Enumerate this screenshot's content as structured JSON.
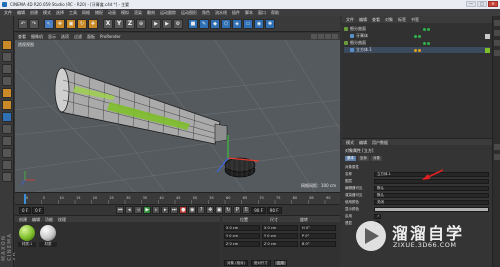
{
  "window": {
    "title": "CINEMA 4D R20.059 Studio (RC - R20) - [牙膏盒.c4d *] - 主要",
    "min": "—",
    "max": "□",
    "close": "✕"
  },
  "menu": [
    "文件",
    "编辑",
    "创建",
    "模式",
    "选择",
    "工具",
    "网格",
    "捕捉",
    "动画",
    "模拟",
    "渲染",
    "雕刻",
    "运动跟踪",
    "运动图形",
    "角色",
    "流水线",
    "插件",
    "脚本",
    "窗口",
    "帮助"
  ],
  "toolbar": {
    "axis_x": "X",
    "axis_y": "Y",
    "axis_z": "Z",
    "coord": "⊕"
  },
  "viewport": {
    "menu": [
      "查看",
      "摄像机",
      "显示",
      "选项",
      "过滤",
      "面板",
      "ProRender"
    ],
    "label": "透视视图",
    "grid_info": "网格间距：100 cm"
  },
  "timeline": {
    "ticks": [
      "0",
      "5",
      "10",
      "15",
      "20",
      "25",
      "30",
      "35",
      "40",
      "45",
      "50",
      "55",
      "60",
      "65",
      "70",
      "75",
      "80",
      "85",
      "90"
    ],
    "end_marker": "0 F"
  },
  "playback": {
    "start": "0 F",
    "current": "0 F",
    "end": "90 F",
    "end2": "90 F"
  },
  "materials": {
    "menu": [
      "创建",
      "编辑",
      "功能",
      "纹理"
    ],
    "items": [
      {
        "label": "材质.1",
        "color": "#7fbf2a"
      },
      {
        "label": "材质",
        "color": "#d9d9d9"
      }
    ]
  },
  "coordinates": {
    "headers": [
      "位置",
      "尺寸",
      "旋转"
    ],
    "rows": [
      [
        "X 0 cm",
        "X 0 cm",
        "H 0°"
      ],
      [
        "Y 0 cm",
        "Y 0 cm",
        "P 0°"
      ],
      [
        "Z 0 cm",
        "Z 0 cm",
        "B 0°"
      ]
    ],
    "mode": "对象 (相对)",
    "size_mode": "绝对尺寸",
    "apply": "应用"
  },
  "objects": {
    "tabs": [
      "文件",
      "编辑",
      "查看",
      "对象",
      "标签",
      "书签"
    ],
    "rows": [
      {
        "name": "细分曲面",
        "indent": 0
      },
      {
        "name": "牙膏体",
        "indent": 1
      },
      {
        "name": "细分曲面",
        "indent": 0
      },
      {
        "name": "立方体.1",
        "indent": 1
      }
    ]
  },
  "attributes": {
    "tabs": [
      "模式",
      "编辑",
      "用户数据"
    ],
    "title": "对象属性 [立方]",
    "subtabs": [
      "基本",
      "坐标",
      "对象"
    ],
    "section": "对象属性",
    "rows": [
      {
        "label": "名称",
        "value": "立方体.1"
      },
      {
        "label": "图层",
        "value": ""
      },
      {
        "label": "编辑器可见",
        "value": "默认"
      },
      {
        "label": "渲染器可见",
        "value": "默认"
      },
      {
        "label": "使用颜色",
        "value": "关闭"
      },
      {
        "label": "显示颜色",
        "value": ""
      },
      {
        "label": "启用",
        "value": "✓"
      },
      {
        "label": "透显",
        "value": ""
      }
    ]
  },
  "watermark": {
    "cn": "溜溜自学",
    "url": "ZIXUE.3D66.COM"
  },
  "logo": "MAXON CINEMA 4D"
}
